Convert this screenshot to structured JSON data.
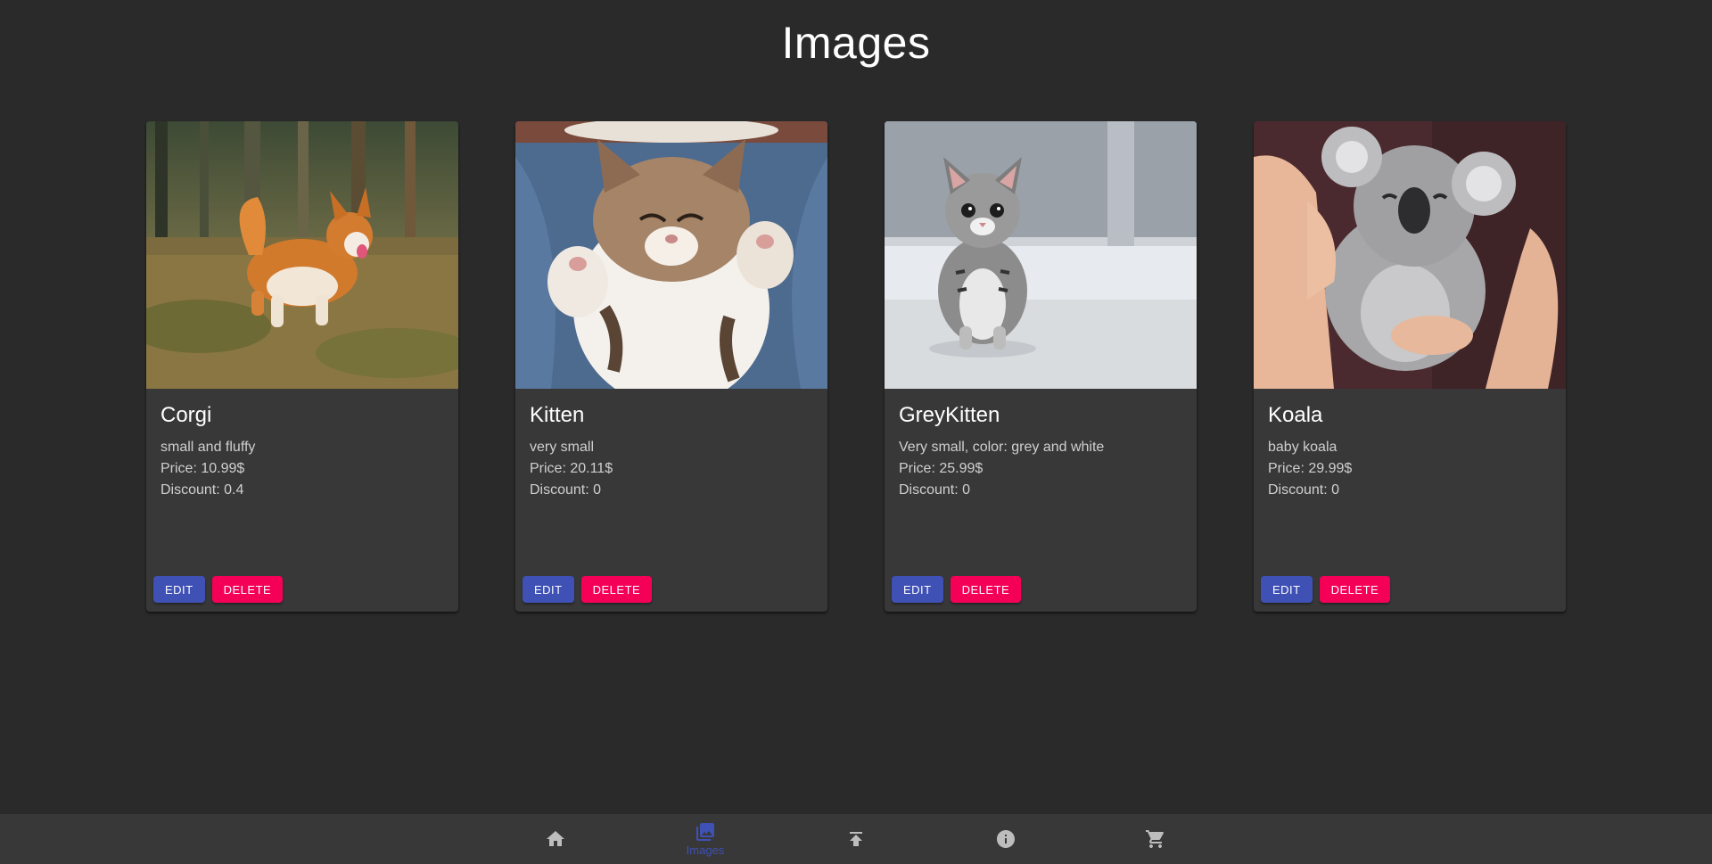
{
  "header": {
    "title": "Images"
  },
  "cards": [
    {
      "title": "Corgi",
      "description": "small and fluffy",
      "price": "Price: 10.99$",
      "discount": "Discount: 0.4",
      "edit_label": "EDIT",
      "delete_label": "DELETE",
      "image": "corgi-photo"
    },
    {
      "title": "Kitten",
      "description": "very small",
      "price": "Price: 20.11$",
      "discount": "Discount: 0",
      "edit_label": "EDIT",
      "delete_label": "DELETE",
      "image": "kitten-photo"
    },
    {
      "title": "GreyKitten",
      "description": "Very small, color: grey and white",
      "price": "Price: 25.99$",
      "discount": "Discount: 0",
      "edit_label": "EDIT",
      "delete_label": "DELETE",
      "image": "grey-kitten-photo"
    },
    {
      "title": "Koala",
      "description": "baby koala",
      "price": "Price: 29.99$",
      "discount": "Discount: 0",
      "edit_label": "EDIT",
      "delete_label": "DELETE",
      "image": "koala-photo"
    }
  ],
  "bottom_nav": {
    "items": [
      {
        "icon": "home-icon",
        "label": "",
        "active": false
      },
      {
        "icon": "photo-library-icon",
        "label": "Images",
        "active": true
      },
      {
        "icon": "upload-icon",
        "label": "",
        "active": false
      },
      {
        "icon": "info-icon",
        "label": "",
        "active": false
      },
      {
        "icon": "cart-icon",
        "label": "",
        "active": false
      }
    ]
  },
  "colors": {
    "background": "#2a2a2a",
    "card": "#383838",
    "primary": "#3f51b5",
    "secondary": "#f50057",
    "nav_icon": "#bdbdbd"
  }
}
